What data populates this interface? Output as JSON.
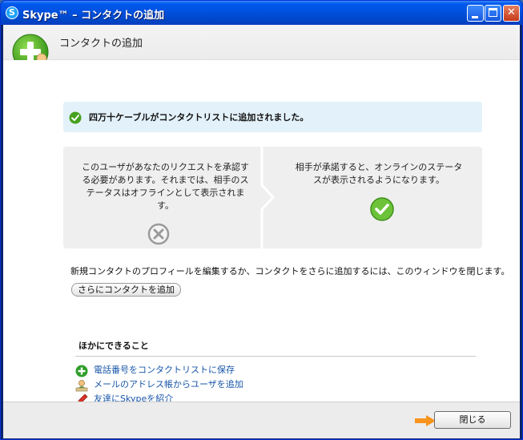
{
  "window": {
    "title": "Skype™ – コンタクトの追加",
    "app_glyph": "S",
    "minimize_icon": "minimize-icon",
    "maximize_icon": "maximize-icon",
    "close_icon": "close-icon",
    "close_glyph": "✕"
  },
  "header": {
    "title": "コンタクトの追加",
    "icon": "add-contact-icon"
  },
  "banner": {
    "icon": "success-check-icon",
    "text": "四万十ケーブルがコンタクトリストに追加されました。"
  },
  "steps": {
    "left_text": "このユーザがあなたのリクエストを承認する必要があります。それまでは、相手のステータスはオフラインとして表示されます。",
    "left_icon": "offline-status-icon",
    "right_text": "相手が承諾すると、オンラインのステータスが表示されるようになります。",
    "right_icon": "online-status-icon"
  },
  "info_text": "新規コンタクトのプロフィールを編集するか、コンタクトをさらに追加するには、このウィンドウを閉じます。",
  "add_more_button": "さらにコンタクトを追加",
  "more": {
    "title": "ほかにできること",
    "items": [
      {
        "label": "電話番号をコンタクトリストに保存",
        "icon": "add-phone-icon"
      },
      {
        "label": "メールのアドレス帳からユーザを追加",
        "icon": "address-book-icon"
      },
      {
        "label": "友達にSkypeを紹介",
        "icon": "pen-icon"
      }
    ]
  },
  "footer": {
    "close_button": "閉じる",
    "arrow_icon": "arrow-pointer-icon"
  },
  "colors": {
    "titlebar": "#0053e2",
    "link": "#1856a8",
    "banner_bg": "#e3f1fa",
    "success_green": "#5cb82e",
    "arrow_orange": "#f7941d"
  }
}
